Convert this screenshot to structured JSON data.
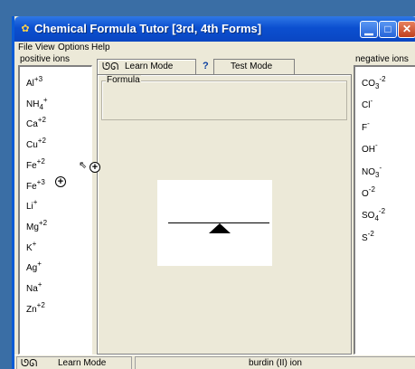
{
  "window": {
    "title": "Chemical Formula Tutor [3rd, 4th Forms]",
    "buttons": [
      "minimize",
      "maximize",
      "close"
    ]
  },
  "menu": [
    "File",
    "View",
    "Options",
    "Help"
  ],
  "positive_ions": {
    "label": "positive ions",
    "items": [
      {
        "base": "Al",
        "sub": "",
        "charge": "+3"
      },
      {
        "base": "NH",
        "sub": "4",
        "charge": "+"
      },
      {
        "base": "Ca",
        "sub": "",
        "charge": "+2"
      },
      {
        "base": "Cu",
        "sub": "",
        "charge": "+2"
      },
      {
        "base": "Fe",
        "sub": "",
        "charge": "+2"
      },
      {
        "base": "Fe",
        "sub": "",
        "charge": "+3"
      },
      {
        "base": "Li",
        "sub": "",
        "charge": "+"
      },
      {
        "base": "Mg",
        "sub": "",
        "charge": "+2"
      },
      {
        "base": "K",
        "sub": "",
        "charge": "+"
      },
      {
        "base": "Ag",
        "sub": "",
        "charge": "+"
      },
      {
        "base": "Na",
        "sub": "",
        "charge": "+"
      },
      {
        "base": "Zn",
        "sub": "",
        "charge": "+2"
      }
    ]
  },
  "negative_ions": {
    "label": "negative ions",
    "items": [
      {
        "base": "CO",
        "sub": "3",
        "charge": "-2"
      },
      {
        "base": "Cl",
        "sub": "",
        "charge": "-"
      },
      {
        "base": "F",
        "sub": "",
        "charge": "-"
      },
      {
        "base": "OH",
        "sub": "",
        "charge": "-"
      },
      {
        "base": "NO",
        "sub": "3",
        "charge": "-"
      },
      {
        "base": "O",
        "sub": "",
        "charge": "-2"
      },
      {
        "base": "SO",
        "sub": "4",
        "charge": "-2"
      },
      {
        "base": "S",
        "sub": "",
        "charge": "-2"
      }
    ]
  },
  "tabs": {
    "learn": "Learn Mode",
    "test": "Test Mode",
    "help_symbol": "?"
  },
  "formula": {
    "legend": "Formula"
  },
  "status": {
    "mode": "Learn Mode",
    "selection": "burdin (II) ion"
  },
  "icons": {
    "app": "flask-icon",
    "mode": "glasses-icon",
    "cursor": "arrow-cursor-icon",
    "plus": "plus-circle-icon"
  }
}
